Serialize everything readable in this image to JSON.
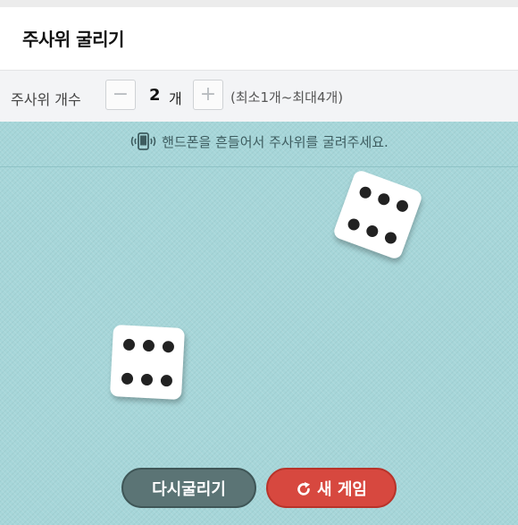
{
  "header": {
    "title": "주사위 굴리기"
  },
  "dice_count": {
    "label": "주사위 개수",
    "minus_label": "−",
    "value": "2",
    "unit": "개",
    "plus_label": "+",
    "range_hint": "(최소1개~최대4개)"
  },
  "board": {
    "hint": "핸드폰을 흔들어서 주사위를 굴려주세요.",
    "hint_icon": "phone-shake-icon",
    "dice": [
      {
        "face": 6
      },
      {
        "face": 6
      }
    ]
  },
  "actions": {
    "reroll_label": "다시굴리기",
    "newgame_label": "새 게임",
    "newgame_icon": "refresh-icon"
  },
  "colors": {
    "board": "#a6d6d9",
    "reroll_button": "#5b7475",
    "newgame_button": "#d7483f"
  }
}
